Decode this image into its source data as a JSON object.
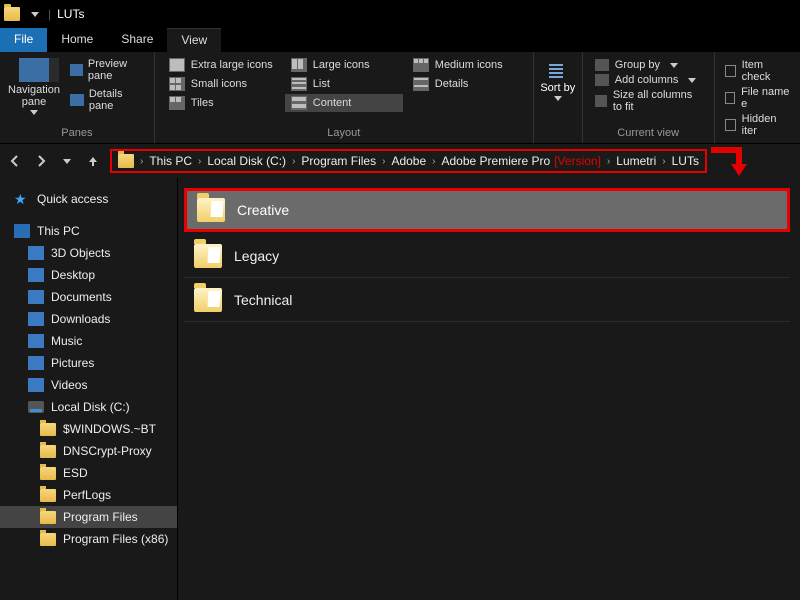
{
  "window": {
    "title": "LUTs"
  },
  "menu": {
    "file": "File",
    "home": "Home",
    "share": "Share",
    "view": "View"
  },
  "ribbon": {
    "panes": {
      "nav_label": "Navigation pane",
      "preview": "Preview pane",
      "details": "Details pane",
      "group": "Panes"
    },
    "layout": {
      "extra_large": "Extra large icons",
      "large": "Large icons",
      "medium": "Medium icons",
      "small": "Small icons",
      "list": "List",
      "details": "Details",
      "tiles": "Tiles",
      "content": "Content",
      "group": "Layout"
    },
    "sort": {
      "label": "Sort by"
    },
    "current_view": {
      "group_by": "Group by",
      "add_cols": "Add columns",
      "size_cols": "Size all columns to fit",
      "group": "Current view"
    },
    "show": {
      "item_check": "Item check",
      "file_ext": "File name e",
      "hidden": "Hidden iter"
    }
  },
  "breadcrumb": {
    "segments": [
      "This PC",
      "Local Disk (C:)",
      "Program Files",
      "Adobe",
      "Adobe Premiere Pro",
      "Lumetri",
      "LUTs"
    ],
    "version_marker": "[Version]"
  },
  "sidebar": {
    "quick": "Quick access",
    "thispc": "This PC",
    "items": [
      "3D Objects",
      "Desktop",
      "Documents",
      "Downloads",
      "Music",
      "Pictures",
      "Videos"
    ],
    "drive": "Local Disk (C:)",
    "drive_children": [
      "$WINDOWS.~BT",
      "DNSCrypt-Proxy",
      "ESD",
      "PerfLogs",
      "Program Files",
      "Program Files (x86)"
    ]
  },
  "content": {
    "folders": [
      "Creative",
      "Legacy",
      "Technical"
    ]
  }
}
